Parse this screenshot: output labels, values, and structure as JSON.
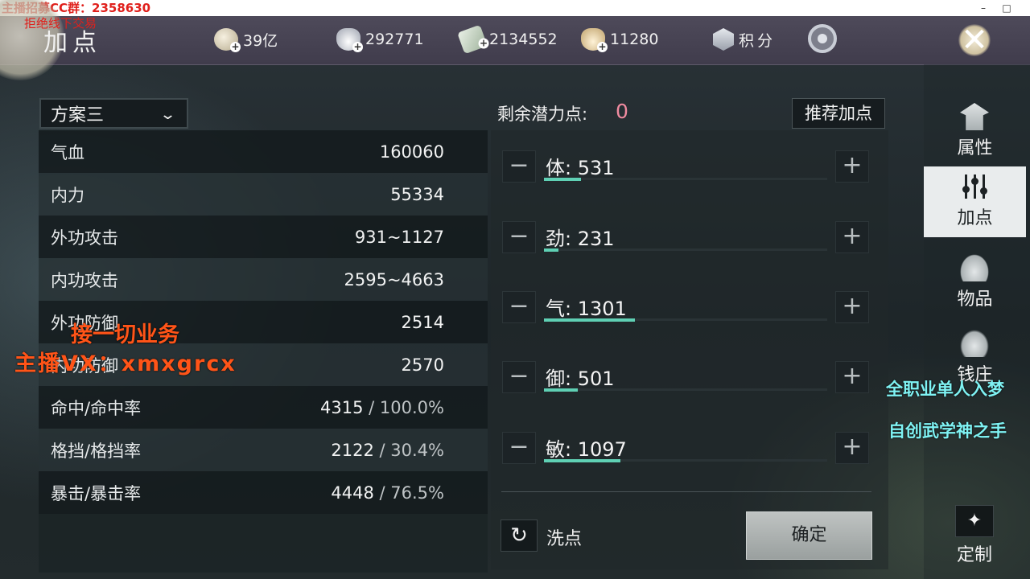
{
  "window": {
    "overlay_top": "主播招募CC群：2358630",
    "minimize": "–",
    "maximize": "□"
  },
  "overlay_notice": "拒绝线下交易",
  "header": {
    "title": "加点",
    "currencies": [
      {
        "icon": "coin-icon",
        "value": "39亿"
      },
      {
        "icon": "silver-ingot-icon",
        "value": "292771"
      },
      {
        "icon": "ticket-icon",
        "value": "2134552"
      },
      {
        "icon": "gold-ingot-icon",
        "value": "11280"
      }
    ],
    "score_label": "积分",
    "close_label": "✕"
  },
  "plan": {
    "selected": "方案三",
    "chevron": "⌄"
  },
  "stats": [
    {
      "name": "气血",
      "value": "160060",
      "secondary": ""
    },
    {
      "name": "内力",
      "value": "55334",
      "secondary": ""
    },
    {
      "name": "外功攻击",
      "value": "931~1127",
      "secondary": ""
    },
    {
      "name": "内功攻击",
      "value": "2595~4663",
      "secondary": ""
    },
    {
      "name": "外功防御",
      "value": "2514",
      "secondary": ""
    },
    {
      "name": "内功防御",
      "value": "2570",
      "secondary": ""
    },
    {
      "name": "命中/命中率",
      "value": "4315",
      "secondary": " / 100.0%"
    },
    {
      "name": "格挡/格挡率",
      "value": "2122",
      "secondary": " / 30.4%"
    },
    {
      "name": "暴击/暴击率",
      "value": "4448",
      "secondary": " / 76.5%"
    }
  ],
  "potential": {
    "label": "剩余潜力点:",
    "value": "0",
    "recommend_label": "推荐加点"
  },
  "attributes": [
    {
      "label": "体: 531",
      "fill": 0.13
    },
    {
      "label": "劲: 231",
      "fill": 0.05
    },
    {
      "label": "气: 1301",
      "fill": 0.32
    },
    {
      "label": "御: 501",
      "fill": 0.12
    },
    {
      "label": "敏: 1097",
      "fill": 0.27
    }
  ],
  "attr_buttons": {
    "minus": "−",
    "plus": "+"
  },
  "actions": {
    "reset_icon": "↻",
    "reset_label": "洗点",
    "confirm_label": "确定"
  },
  "sidebar": {
    "tabs": [
      {
        "label": "属性",
        "icon": "hat-icon",
        "active": false
      },
      {
        "label": "加点",
        "icon": "sliders-icon",
        "active": true
      },
      {
        "label": "物品",
        "icon": "bag-icon",
        "active": false
      },
      {
        "label": "钱庄",
        "icon": "money-bag-icon",
        "active": false
      }
    ],
    "custom_icon": "✦",
    "custom_label": "定制"
  },
  "overlays": {
    "orange_line1": "接一切业务",
    "orange_line2": "主播VX：xmxgrcx",
    "cyan_line1": "全职业单人入梦",
    "cyan_line2": "自创武学神之手"
  },
  "colors": {
    "accent_fill": "#5fd0b4",
    "potential_value": "#f08ba0",
    "overlay_orange": "#ff5418",
    "overlay_cyan": "#7ff3f4"
  }
}
